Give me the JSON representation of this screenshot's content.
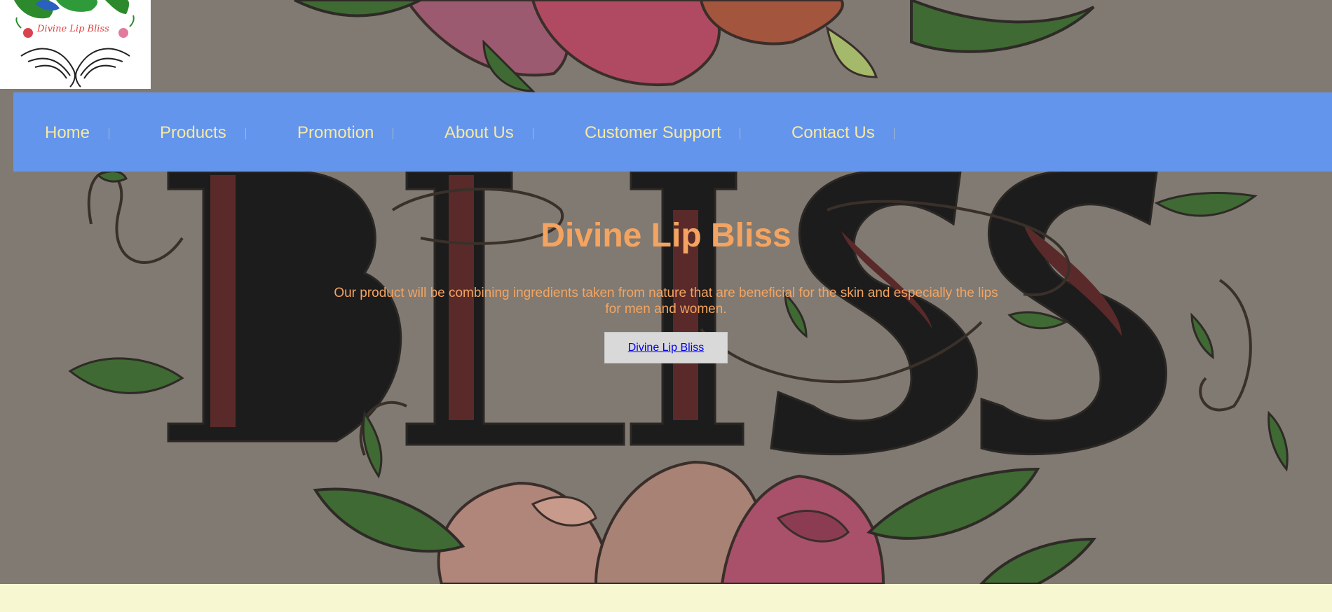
{
  "logo": {
    "text": "Divine Lip Bliss"
  },
  "nav": {
    "items": [
      {
        "label": "Home"
      },
      {
        "label": "Products"
      },
      {
        "label": "Promotion"
      },
      {
        "label": "About Us"
      },
      {
        "label": "Customer Support"
      },
      {
        "label": "Contact Us"
      }
    ]
  },
  "hero": {
    "title": "Divine Lip Bliss",
    "description": "Our product will be combining ingredients taken from nature that are beneficial for the skin and especially the lips for men and women.",
    "button_label": "Divine Lip Bliss"
  },
  "colors": {
    "nav_background": "#6495ed",
    "nav_text": "#f8e9a1",
    "hero_text": "#f4a460",
    "page_background": "#f7f8d2",
    "link": "#0000ee"
  }
}
